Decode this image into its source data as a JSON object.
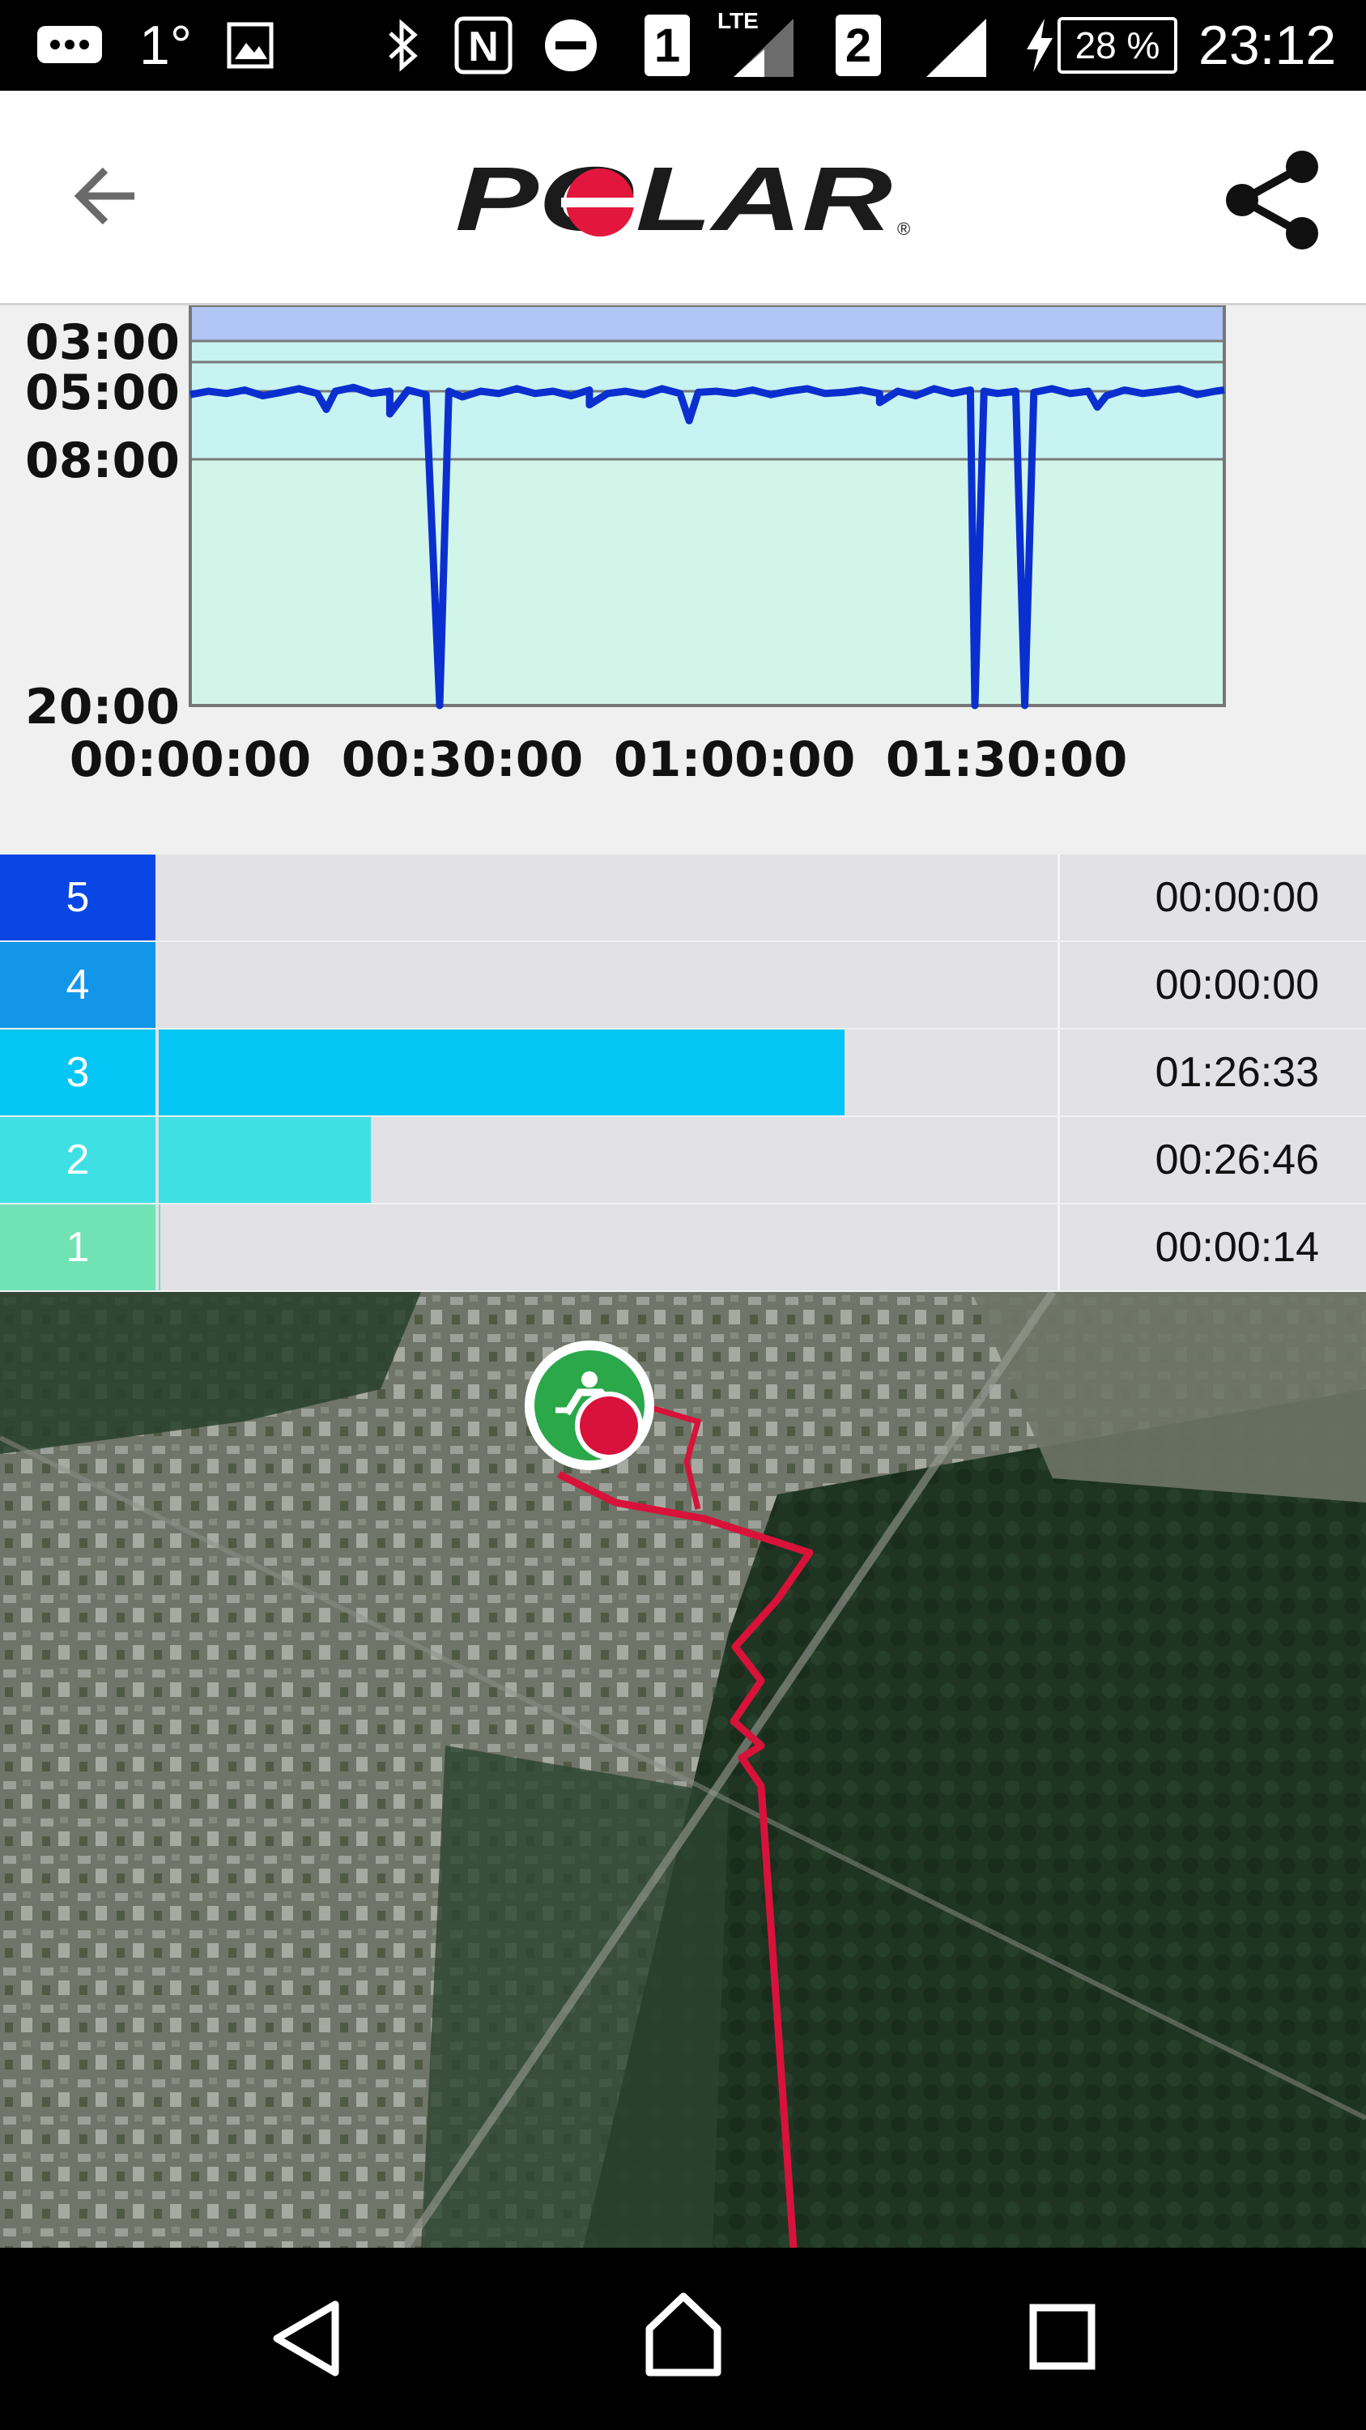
{
  "status_bar": {
    "temperature": "1°",
    "sim1": "1",
    "network": "LTE",
    "sim2": "2",
    "battery": "28 %",
    "time": "23:12",
    "icons": [
      "message-icon",
      "image-icon",
      "bluetooth-icon",
      "nfc-icon",
      "do-not-disturb-icon",
      "signal-icon",
      "charging-icon",
      "battery-icon"
    ]
  },
  "app_bar": {
    "brand": "POLAR",
    "registered": "®",
    "icons": [
      "back-arrow-icon",
      "share-icon"
    ]
  },
  "chart_data": {
    "type": "line",
    "title": "",
    "xlabel": "",
    "ylabel": "",
    "x_ticks": [
      "00:00:00",
      "00:30:00",
      "01:00:00",
      "01:30:00"
    ],
    "y_ticks": [
      "03:00",
      "05:00",
      "08:00",
      "20:00"
    ],
    "x_unit": "minutes",
    "xlim": [
      0,
      114
    ],
    "y_scale": "pace (min/km)",
    "zone_colors": [
      "#b1c6f4",
      "#c8f3f3",
      "#d2f5e9"
    ],
    "line_color": "#0b2fce",
    "series": [
      {
        "baseline_pace": 5.0,
        "points": [
          [
            0,
            5.15
          ],
          [
            2,
            5.0
          ],
          [
            4,
            5.1
          ],
          [
            6,
            4.95
          ],
          [
            8,
            5.2
          ],
          [
            10,
            5.05
          ],
          [
            12,
            4.9
          ],
          [
            14,
            5.1
          ],
          [
            16,
            5.0
          ],
          [
            18,
            4.85
          ],
          [
            20,
            5.1
          ],
          [
            22,
            5.0
          ],
          [
            24,
            4.95
          ],
          [
            26,
            5.15
          ],
          [
            27.5,
            20.0
          ],
          [
            28.5,
            5.0
          ],
          [
            30,
            5.25
          ],
          [
            32,
            5.0
          ],
          [
            34,
            5.1
          ],
          [
            36,
            4.9
          ],
          [
            38,
            5.1
          ],
          [
            40,
            5.0
          ],
          [
            42,
            5.2
          ],
          [
            44,
            4.95
          ],
          [
            46,
            5.1
          ],
          [
            48,
            5.0
          ],
          [
            50,
            5.15
          ],
          [
            52,
            4.9
          ],
          [
            54,
            5.1
          ],
          [
            55,
            6.3
          ],
          [
            56,
            5.05
          ],
          [
            58,
            5.0
          ],
          [
            60,
            5.1
          ],
          [
            62,
            4.95
          ],
          [
            64,
            5.15
          ],
          [
            66,
            5.0
          ],
          [
            68,
            4.9
          ],
          [
            70,
            5.1
          ],
          [
            72,
            5.05
          ],
          [
            74,
            4.95
          ],
          [
            76,
            5.1
          ],
          [
            78,
            5.0
          ],
          [
            80,
            5.2
          ],
          [
            82,
            4.9
          ],
          [
            84,
            5.1
          ],
          [
            86,
            4.95
          ],
          [
            86.5,
            20.0
          ],
          [
            87.5,
            5.0
          ],
          [
            89,
            5.1
          ],
          [
            91,
            5.0
          ],
          [
            92,
            20.0
          ],
          [
            93,
            5.05
          ],
          [
            95,
            4.9
          ],
          [
            97,
            5.1
          ],
          [
            99,
            5.0
          ],
          [
            101,
            5.2
          ],
          [
            103,
            4.95
          ],
          [
            105,
            5.1
          ],
          [
            107,
            5.0
          ],
          [
            109,
            4.9
          ],
          [
            111,
            5.15
          ],
          [
            113,
            5.0
          ],
          [
            114,
            4.95
          ]
        ]
      }
    ],
    "dips": [
      [
        15,
        5.8
      ],
      [
        22,
        6.0
      ],
      [
        44,
        5.6
      ],
      [
        76,
        5.5
      ],
      [
        100,
        5.7
      ]
    ]
  },
  "zones": [
    {
      "zone": "5",
      "time": "00:00:00",
      "fraction": 0.0,
      "color": "#0a46e6"
    },
    {
      "zone": "4",
      "time": "00:00:00",
      "fraction": 0.0,
      "color": "#1496e8"
    },
    {
      "zone": "3",
      "time": "01:26:33",
      "fraction": 0.763,
      "color": "#06c6f5"
    },
    {
      "zone": "2",
      "time": "00:26:46",
      "fraction": 0.236,
      "color": "#3ee0e3"
    },
    {
      "zone": "1",
      "time": "00:00:14",
      "fraction": 0.002,
      "color": "#70e2b4"
    }
  ],
  "map": {
    "route_color": "#d8123a",
    "start_marker_color": "#2aa84a",
    "end_marker_color": "#d8123a",
    "icons": [
      "running-icon"
    ]
  },
  "nav_bar": {
    "icons": [
      "nav-back-icon",
      "nav-home-icon",
      "nav-recents-icon"
    ]
  }
}
